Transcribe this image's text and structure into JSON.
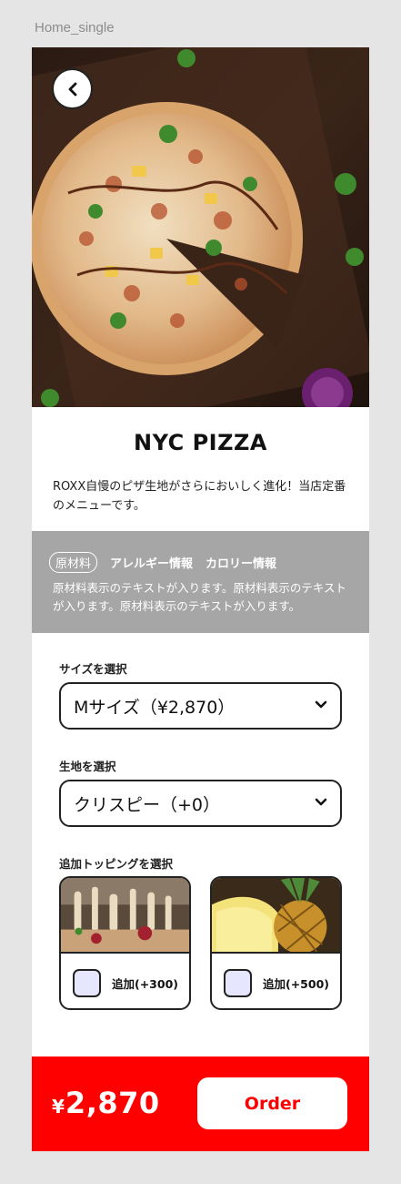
{
  "frame_label": "Home_single",
  "product": {
    "name": "NYC PIZZA",
    "description": "ROXX自慢のピザ生地がさらにおいしく進化！当店定番のメニューです。"
  },
  "info": {
    "tabs": [
      "原材料",
      "アレルギー情報",
      "カロリー情報"
    ],
    "active_tab": "原材料",
    "text": "原材料表示のテキストが入ります。原材料表示のテキストが入ります。原材料表示のテキストが入ります。"
  },
  "size_select": {
    "label": "サイズを選択",
    "value": "Mサイズ（¥2,870）"
  },
  "crust_select": {
    "label": "生地を選択",
    "value": "クリスピー（+0）"
  },
  "toppings": {
    "label": "追加トッピングを選択",
    "items": [
      {
        "label": "追加(+300)",
        "image": "cheese-topping",
        "checked": false
      },
      {
        "label": "追加(+500)",
        "image": "pineapple-topping",
        "checked": false
      }
    ]
  },
  "footer": {
    "currency": "¥",
    "price": "2,870",
    "order_label": "Order",
    "bar_color": "#ff0000"
  }
}
